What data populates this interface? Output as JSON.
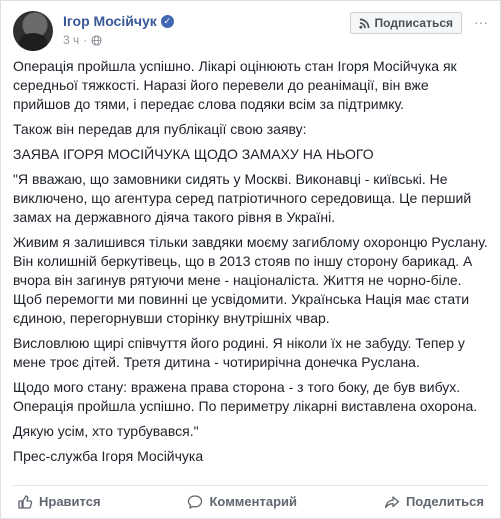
{
  "header": {
    "author": "Ігор Мосійчук",
    "time": "3 ч",
    "subscribe_label": "Подписаться",
    "more_label": "···"
  },
  "post": {
    "paragraphs": [
      "Операція пройшла успішно. Лікарі оцінюють стан Ігоря Мосійчука як середньої тяжкості. Наразі його перевели до реанімації, він вже прийшов до тями, і передає слова подяки всім за підтримку.",
      "Також він передав для публікації свою заяву:",
      "ЗАЯВА ІГОРЯ МОСІЙЧУКА ЩОДО ЗАМАХУ НА НЬОГО",
      "\"Я вважаю, що замовники сидять у Москві. Виконавці - київські. Не виключено, що агентура серед патріотичного середовища. Це перший замах на державного діяча такого рівня в Україні.",
      "Живим я залишився тільки завдяки моєму загиблому охоронцю Руслану. Він колишній беркутівець, що в 2013 стояв по іншу сторону барикад. А вчора він загинув рятуючи мене - націоналіста. Життя не чорно-біле. Щоб перемогти ми повинні це усвідомити. Українська Нація має стати єдиною, перегорнувши сторінку внутрішніх чвар.",
      "Висловлюю щирі співчуття його родині. Я ніколи їх не забуду. Тепер у мене троє дітей. Третя дитина - чотирирічна донечка Руслана.",
      "Щодо мого стану: вражена права сторона - з того боку, де був вибух. Операція пройшла успішно. По периметру лікарні виставлена охорона.",
      "Дякую усім, хто турбувався.\"",
      "Прес-служба Ігоря Мосійчука"
    ]
  },
  "actions": {
    "like": "Нравится",
    "comment": "Комментарий",
    "share": "Поделиться"
  },
  "colors": {
    "author_link": "#385898",
    "meta_text": "#90949c",
    "action_text": "#606770"
  }
}
